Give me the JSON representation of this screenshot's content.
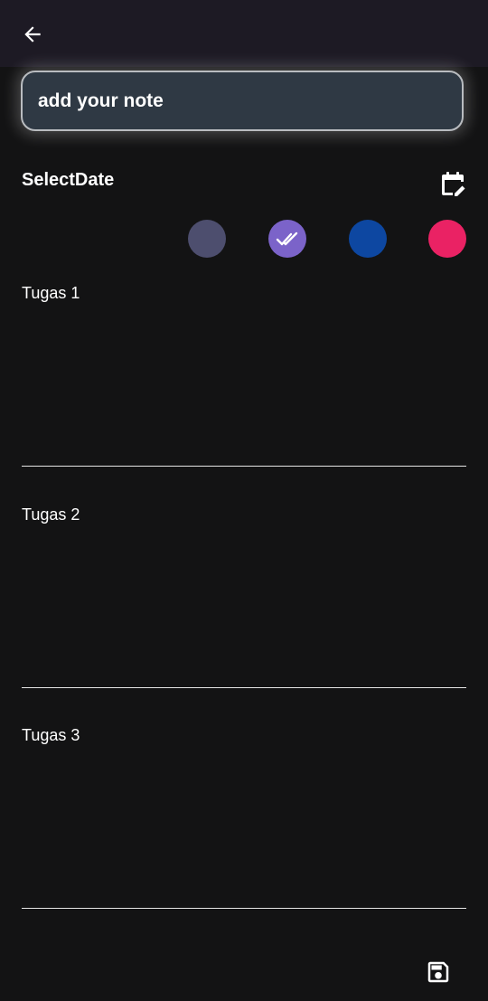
{
  "header": {
    "back_icon": "arrow-left-icon"
  },
  "note": {
    "title_placeholder": "add your note"
  },
  "date": {
    "label": "SelectDate",
    "calendar_icon": "calendar-edit-icon"
  },
  "colors": {
    "options": [
      "#4d4e6e",
      "#7b63c9",
      "#0d47a1",
      "#ea2264"
    ],
    "selected_index": 1,
    "check_icon": "double-check-icon"
  },
  "tasks": [
    {
      "label": "Tugas 1"
    },
    {
      "label": "Tugas 2"
    },
    {
      "label": "Tugas 3"
    }
  ],
  "footer": {
    "save_icon": "save-icon"
  },
  "theme": {
    "background": "#131314",
    "appbar": "#1d1a24",
    "input_fill": "#2f3944"
  }
}
